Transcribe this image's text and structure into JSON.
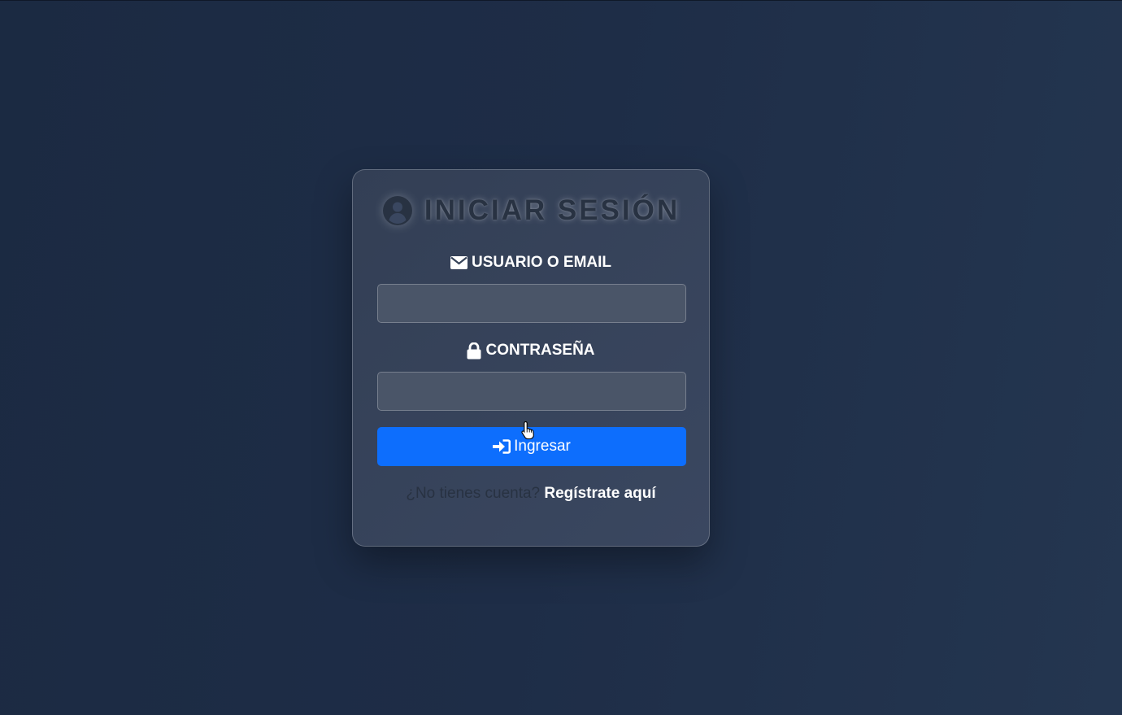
{
  "login": {
    "title": "INICIAR SESIÓN",
    "title_icon": "user-circle-icon",
    "user_label": "USUARIO O EMAIL",
    "user_icon": "envelope-icon",
    "user_value": "",
    "password_label": "CONTRASEÑA",
    "password_icon": "lock-icon",
    "password_value": "",
    "submit_label": "Ingresar",
    "submit_icon": "sign-in-icon",
    "register_prompt": "¿No tienes cuenta?",
    "register_link": "Regístrate aquí"
  },
  "colors": {
    "background": "#1e2d47",
    "card": "#364359",
    "input": "#4a5568",
    "primary_button": "#0d6efd",
    "title_text": "#283242",
    "link": "#ffffff"
  }
}
